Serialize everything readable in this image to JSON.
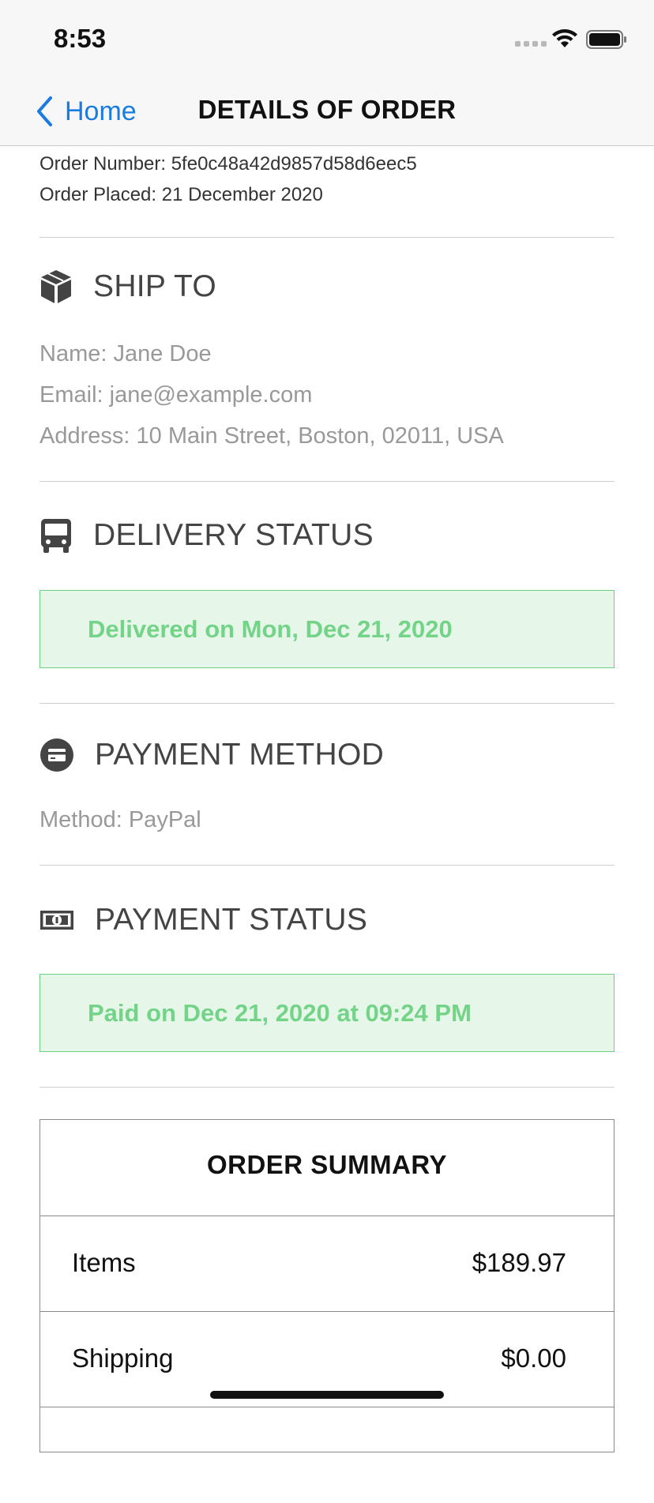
{
  "status_bar": {
    "time": "8:53"
  },
  "nav": {
    "back_label": "Home",
    "title": "DETAILS OF ORDER"
  },
  "order": {
    "number_line": "Order Number: 5fe0c48a42d9857d58d6eec5",
    "placed_line": "Order Placed: 21 December 2020"
  },
  "ship_to": {
    "title": "SHIP TO",
    "icon": "package-icon",
    "name": "Name: Jane Doe",
    "email": "Email: jane@example.com",
    "address": "Address: 10 Main Street, Boston, 02011, USA"
  },
  "delivery": {
    "title": "DELIVERY STATUS",
    "icon": "bus-icon",
    "status": "Delivered on Mon, Dec 21, 2020"
  },
  "payment_method": {
    "title": "PAYMENT METHOD",
    "icon": "credit-card-icon",
    "method": "Method: PayPal"
  },
  "payment_status": {
    "title": "PAYMENT STATUS",
    "icon": "money-bill-icon",
    "status": "Paid on Dec 21, 2020 at 09:24 PM"
  },
  "summary": {
    "title": "ORDER SUMMARY",
    "rows": [
      {
        "label": "Items",
        "value": "$189.97"
      },
      {
        "label": "Shipping",
        "value": "$0.00"
      }
    ]
  },
  "colors": {
    "link_blue": "#1a7ce0",
    "success_green": "#73d488",
    "success_bg": "#e6f7ea"
  }
}
